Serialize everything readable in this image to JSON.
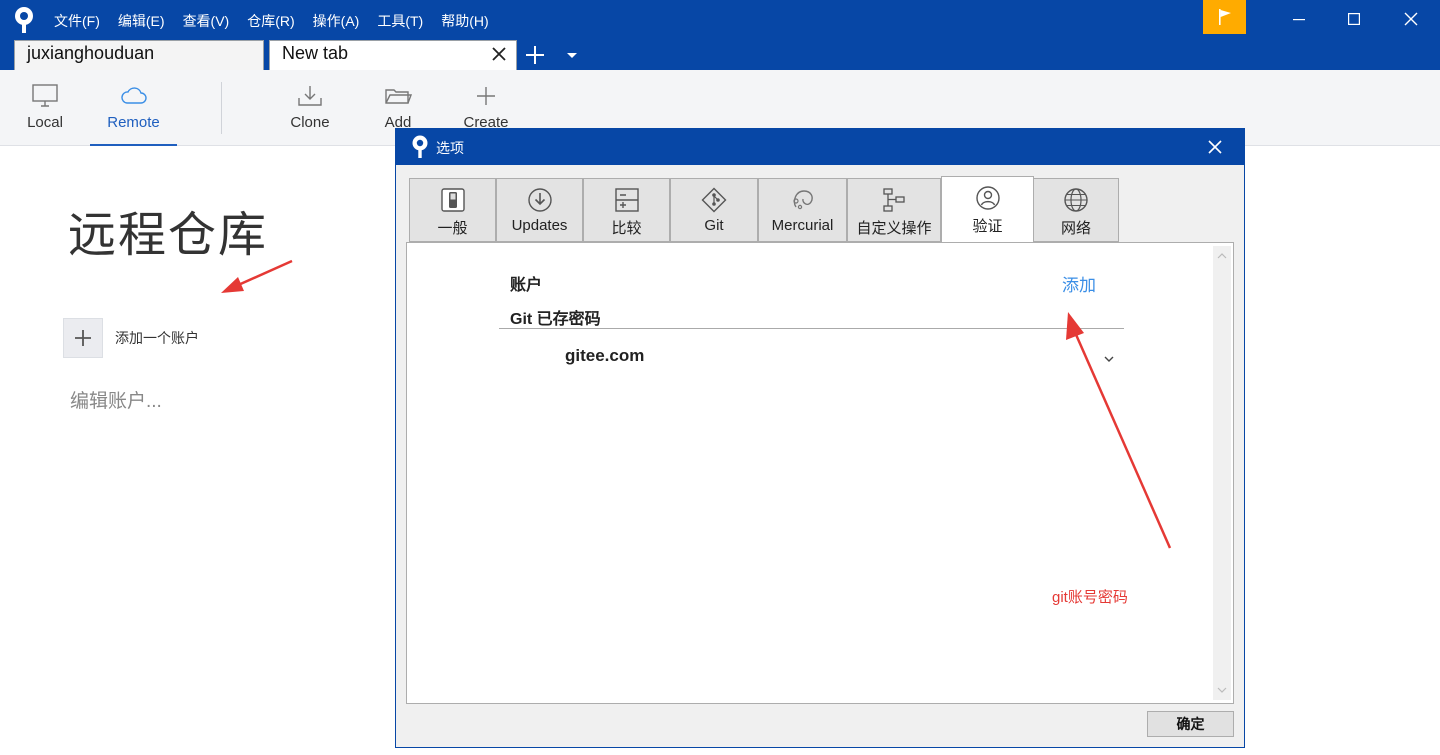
{
  "menu": [
    "文件(F)",
    "编辑(E)",
    "查看(V)",
    "仓库(R)",
    "操作(A)",
    "工具(T)",
    "帮助(H)"
  ],
  "tabs": [
    {
      "label": "juxianghouduan"
    },
    {
      "label": "New tab"
    }
  ],
  "toolbar": {
    "local": "Local",
    "remote": "Remote",
    "clone": "Clone",
    "add": "Add",
    "create": "Create"
  },
  "remote_page": {
    "title": "远程仓库",
    "add_account": "添加一个账户",
    "edit_accounts": "编辑账户..."
  },
  "dialog": {
    "title": "选项",
    "tabs": [
      "一般",
      "Updates",
      "比较",
      "Git",
      "Mercurial",
      "自定义操作",
      "验证",
      "网络"
    ],
    "active_tab": "验证",
    "accounts_label": "账户",
    "add_label": "添加",
    "git_saved_label": "Git 已存密码",
    "hosts": [
      "gitee.com"
    ],
    "ok_label": "确定"
  },
  "annotation": "git账号密码",
  "colors": {
    "titlebar": "#0747a6",
    "flag": "#ffab00",
    "accent": "#1f5fbf",
    "annotation": "#e53935"
  },
  "icons": [
    "sourcetree-logo-icon",
    "flag-icon",
    "minimize-icon",
    "maximize-icon",
    "close-icon",
    "plus-icon",
    "chevron-down-icon",
    "monitor-icon",
    "cloud-icon",
    "download-icon",
    "folder-icon"
  ]
}
